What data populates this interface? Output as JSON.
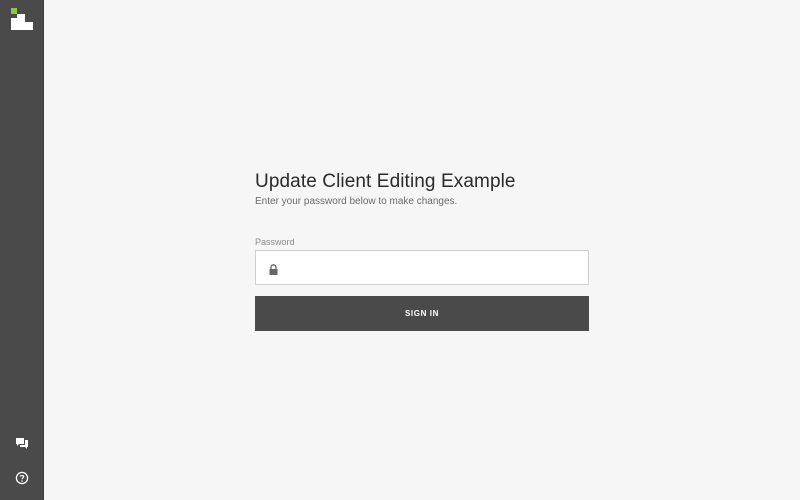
{
  "page": {
    "title": "Update Client Editing Example",
    "subtitle": "Enter your password below to make changes."
  },
  "form": {
    "password_label": "Password",
    "password_value": "",
    "password_placeholder": "",
    "signin_label": "SIGN IN"
  },
  "sidebar": {
    "icons": [
      "logo-icon",
      "chat-icon",
      "help-icon"
    ]
  },
  "colors": {
    "sidebar_bg": "#4a4a4a",
    "page_bg": "#f6f6f6",
    "button_bg": "#4a4a4a",
    "logo_accent": "#8cc63f"
  }
}
